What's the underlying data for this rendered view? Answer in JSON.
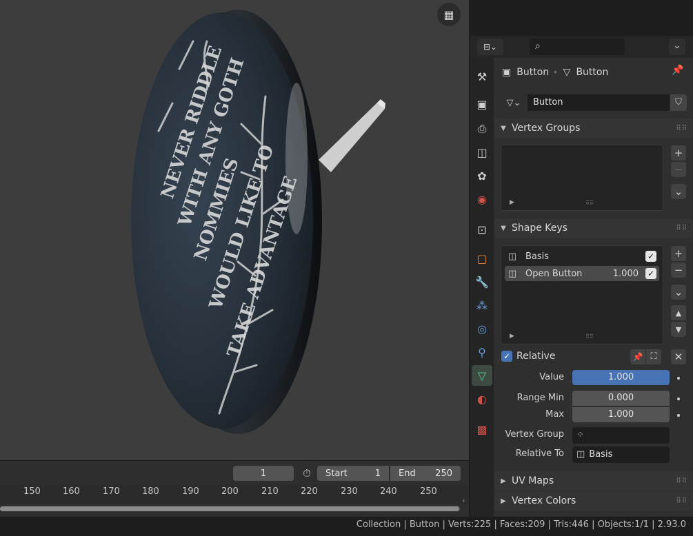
{
  "viewport": {
    "nav_gizmo_icon": "grid-view-icon",
    "button_text": "NEVER RIDDLE WITH ANY GOTH ... NOMMIES ... WOULD LIKE TO TAKE ADVANTAGE"
  },
  "timeline": {
    "current_frame": "1",
    "start_label": "Start",
    "start_value": "1",
    "end_label": "End",
    "end_value": "250",
    "ticks": [
      "150",
      "160",
      "170",
      "180",
      "190",
      "200",
      "210",
      "220",
      "230",
      "240",
      "250"
    ]
  },
  "status_bar": {
    "text": "Collection | Button | Verts:225 | Faces:209 | Tris:446 | Objects:1/1 | 2.93.0"
  },
  "properties": {
    "breadcrumb": {
      "object": "Button",
      "mesh": "Button"
    },
    "mesh_datablock": "Button",
    "vertex_groups": {
      "title": "Vertex Groups"
    },
    "shape_keys": {
      "title": "Shape Keys",
      "items": [
        {
          "name": "Basis",
          "value": "",
          "checked": true
        },
        {
          "name": "Open Button",
          "value": "1.000",
          "checked": true
        }
      ],
      "relative_label": "Relative",
      "value_label": "Value",
      "value": "1.000",
      "range_min_label": "Range Min",
      "range_min": "0.000",
      "max_label": "Max",
      "max": "1.000",
      "vertex_group_label": "Vertex Group",
      "relative_to_label": "Relative To",
      "relative_to": "Basis"
    },
    "uv_maps": {
      "title": "UV Maps"
    },
    "vertex_colors": {
      "title": "Vertex Colors"
    }
  },
  "colors": {
    "accent_blue": "#4772b3",
    "active_tab_green": "#3d4a42",
    "viewport_bg": "#3d3d3d"
  }
}
